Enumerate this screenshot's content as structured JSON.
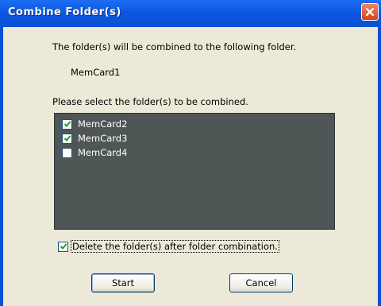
{
  "window": {
    "title": "Combine Folder(s)"
  },
  "dialog": {
    "intro_text": "The folder(s) will be combined to the following folder.",
    "target_folder": "MemCard1",
    "select_prompt": "Please select the folder(s) to be combined.",
    "folders": [
      {
        "label": "MemCard2",
        "checked": true
      },
      {
        "label": "MemCard3",
        "checked": true
      },
      {
        "label": "MemCard4",
        "checked": false
      }
    ],
    "delete_option": {
      "label": "Delete the folder(s) after folder combination.",
      "checked": true
    },
    "start_label": "Start",
    "cancel_label": "Cancel"
  },
  "colors": {
    "titlebar": "#0c58e2",
    "client_bg": "#ece9d8",
    "list_bg": "#4f5656",
    "close_button": "#d8421e",
    "check_mark": "#21a121"
  },
  "icons": {
    "close": "close-icon",
    "check": "checkmark-icon"
  }
}
